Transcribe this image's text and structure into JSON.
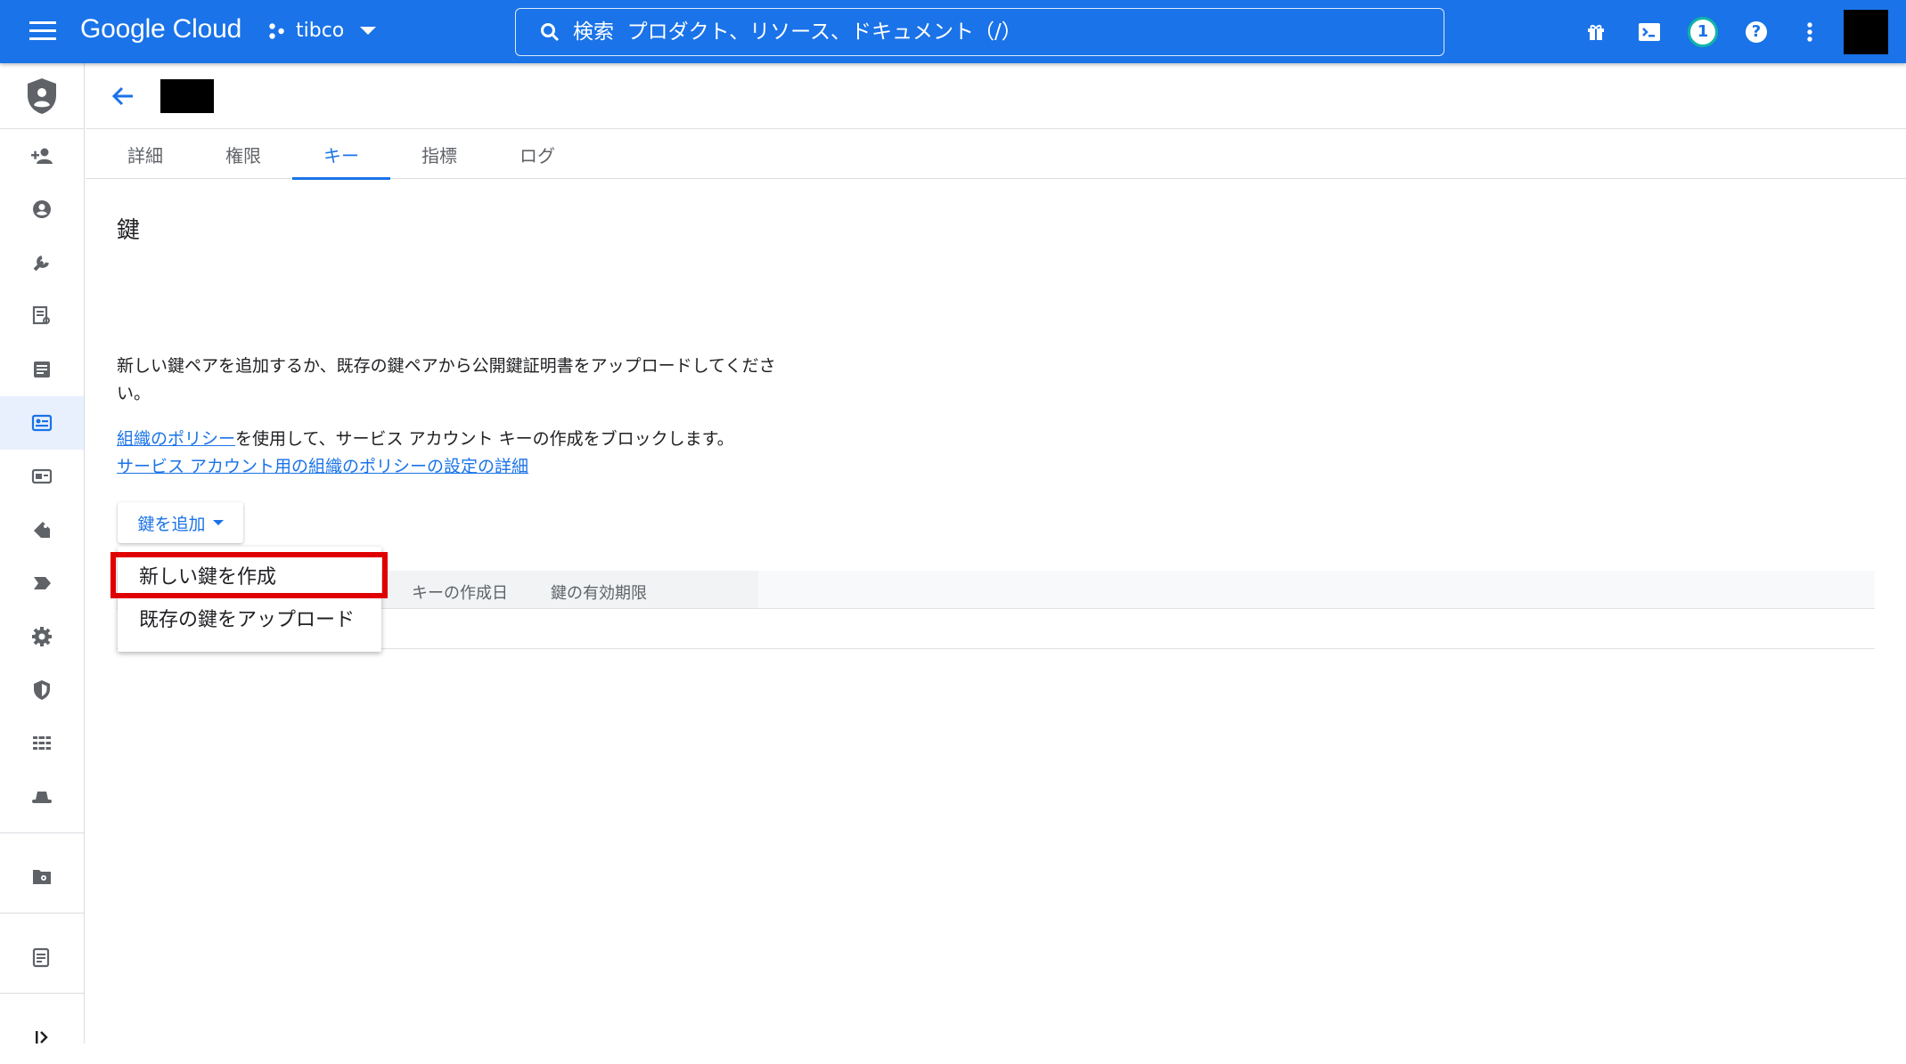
{
  "topbar": {
    "brand": "Google Cloud",
    "project": "tibco",
    "search_placeholder": "検索  プロダクト、リソース、ドキュメント（/）",
    "notification_count": "1",
    "help_label": "?"
  },
  "tabs": [
    {
      "label": "詳細"
    },
    {
      "label": "権限"
    },
    {
      "label": "キー"
    },
    {
      "label": "指標"
    },
    {
      "label": "ログ"
    }
  ],
  "active_tab": "キー",
  "content": {
    "title": "鍵",
    "description": "新しい鍵ペアを追加するか、既存の鍵ペアから公開鍵証明書をアップロードしてください。",
    "policy_link": "組織のポリシー",
    "policy_text": "を使用して、サービス アカウント キーの作成をブロックします。",
    "policy_detail_link": "サービス アカウント用の組織のポリシーの設定の詳細",
    "add_key_button": "鍵を追加"
  },
  "dropdown": {
    "items": [
      {
        "label": "新しい鍵を作成"
      },
      {
        "label": "既存の鍵をアップロード"
      }
    ],
    "highlighted": "新しい鍵を作成",
    "highlight_color": "#e00000"
  },
  "table": {
    "columns": [
      "キーの作成日",
      "鍵の有効期限"
    ]
  },
  "colors": {
    "primary": "#1a73e8",
    "active_rail_bg": "#e8f0fe"
  }
}
